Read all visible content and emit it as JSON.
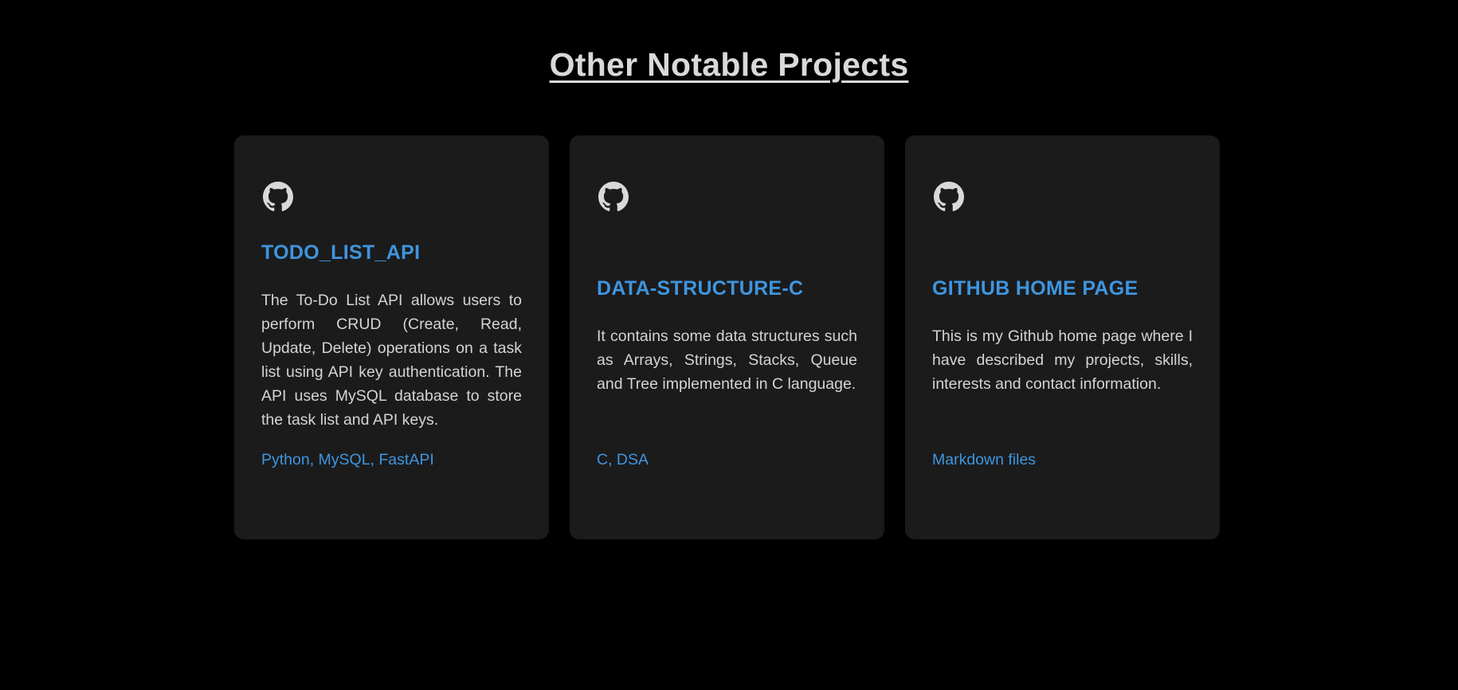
{
  "section": {
    "title": "Other Notable Projects"
  },
  "projects": [
    {
      "icon": "github-icon",
      "title": "TODO_LIST_API",
      "description": "The To-Do List API allows users to perform CRUD (Create, Read, Update, Delete) operations on a task list using API key authentication. The API uses MySQL database to store the task list and API keys.",
      "tech": "Python, MySQL, FastAPI"
    },
    {
      "icon": "github-icon",
      "title": "DATA-STRUCTURE-C",
      "description": "It contains some data structures such as Arrays, Strings, Stacks, Queue and Tree implemented in C language.",
      "tech": "C, DSA"
    },
    {
      "icon": "github-icon",
      "title": "GITHUB HOME PAGE",
      "description": "This is my Github home page where I have described my projects, skills, interests and contact information.",
      "tech": "Markdown files"
    }
  ],
  "colors": {
    "background": "#000000",
    "card": "#1b1b1c",
    "accent": "#3f95de",
    "text": "#d4d4d4"
  }
}
